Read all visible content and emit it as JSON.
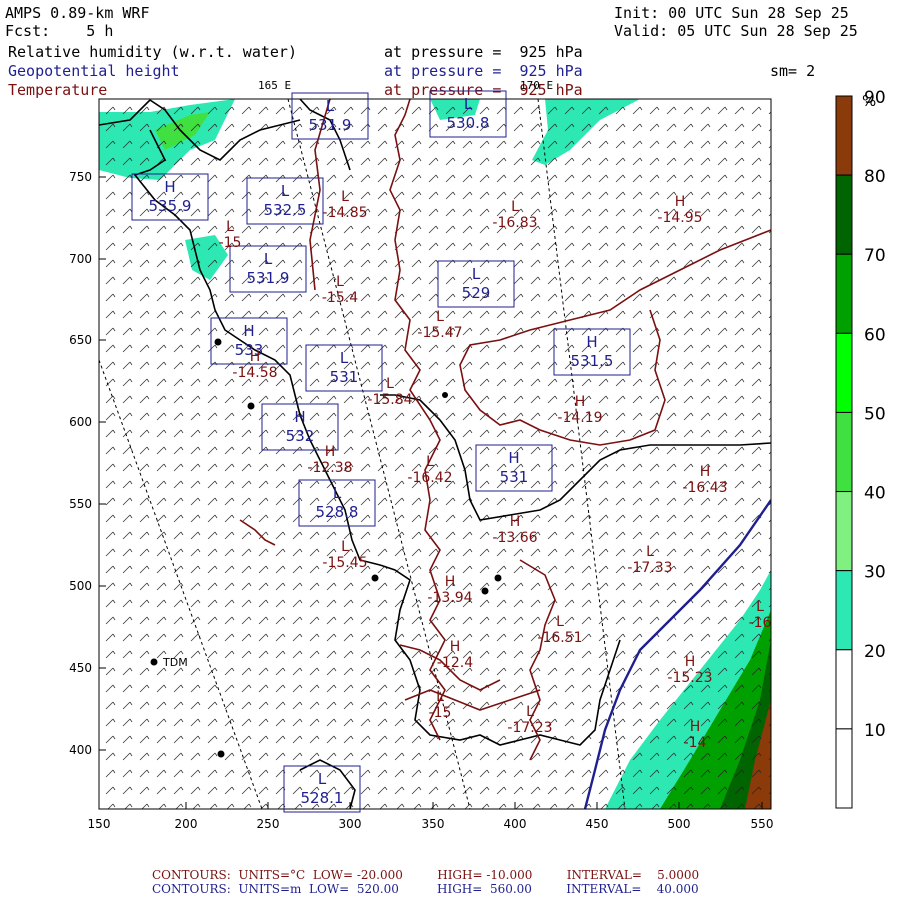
{
  "header": {
    "model": "AMPS 0.89-km WRF",
    "forecast": "Fcst:    5 h",
    "init": "Init: 00 UTC Sun 28 Sep 25",
    "valid": "Valid: 05 UTC Sun 28 Sep 25",
    "field1_name": "Relative humidity (w.r.t. water)",
    "field1_level": "at pressure =  925 hPa",
    "field2_name": "Geopotential height",
    "field2_level": "at pressure =  925 hPa",
    "field3_name": "Temperature",
    "field3_level": "at pressure =  925 hPa",
    "smoothing": "sm= 2",
    "meridian_165": "165 E",
    "meridian_170": "170 E"
  },
  "colorbar": {
    "unit": "%",
    "labels": [
      "10",
      "20",
      "30",
      "40",
      "50",
      "60",
      "70",
      "80",
      "90"
    ],
    "colors": [
      "#ffffff",
      "#ffffff",
      "#2ee8b4",
      "#80f080",
      "#40e040",
      "#00ff00",
      "#00a000",
      "#006400",
      "#8b3a0a"
    ]
  },
  "axes": {
    "x_ticks": [
      "150",
      "200",
      "250",
      "300",
      "350",
      "400",
      "450",
      "500",
      "550"
    ],
    "y_ticks": [
      "400",
      "450",
      "500",
      "550",
      "600",
      "650",
      "700",
      "750"
    ]
  },
  "height_labels": [
    {
      "tag": "H",
      "value": "535.9"
    },
    {
      "tag": "L",
      "value": "532.5"
    },
    {
      "tag": "L",
      "value": "531.9"
    },
    {
      "tag": "L",
      "value": "531.9"
    },
    {
      "tag": "L",
      "value": "530.8"
    },
    {
      "tag": "L",
      "value": "529"
    },
    {
      "tag": "H",
      "value": "533"
    },
    {
      "tag": "L",
      "value": "531"
    },
    {
      "tag": "H",
      "value": "532"
    },
    {
      "tag": "H",
      "value": "531.5"
    },
    {
      "tag": "H",
      "value": "531"
    },
    {
      "tag": "L",
      "value": "528.8"
    },
    {
      "tag": "L",
      "value": "528.1"
    }
  ],
  "temp_labels": [
    {
      "tag": "L",
      "value": "-14.85"
    },
    {
      "tag": "L",
      "value": "-16.83"
    },
    {
      "tag": "H",
      "value": "-14.95"
    },
    {
      "tag": "L",
      "value": "-15.4"
    },
    {
      "tag": "L",
      "value": "-15.47"
    },
    {
      "tag": "H",
      "value": "-14.58"
    },
    {
      "tag": "L",
      "value": "-15.84"
    },
    {
      "tag": "H",
      "value": "-14.19"
    },
    {
      "tag": "H",
      "value": "-12.38"
    },
    {
      "tag": "L",
      "value": "-16.42"
    },
    {
      "tag": "H",
      "value": "-16.43"
    },
    {
      "tag": "H",
      "value": "-13.66"
    },
    {
      "tag": "L",
      "value": "-15.45"
    },
    {
      "tag": "H",
      "value": "-13.94"
    },
    {
      "tag": "L",
      "value": "-17.33"
    },
    {
      "tag": "L",
      "value": "-16.51"
    },
    {
      "tag": "H",
      "value": "-12.4"
    },
    {
      "tag": "H",
      "value": "-15.23"
    },
    {
      "tag": "L",
      "value": "-15"
    },
    {
      "tag": "L",
      "value": "-17.23"
    },
    {
      "tag": "H",
      "value": "-14"
    },
    {
      "tag": "L",
      "value": "-16"
    },
    {
      "tag": "L",
      "value": "-15"
    }
  ],
  "stations": [
    {
      "label": "TDM"
    }
  ],
  "footer": {
    "line1": "CONTOURS:  UNITS=°C  LOW= -20.000         HIGH= -10.000         INTERVAL=    5.0000",
    "line2": "CONTOURS:  UNITS=m  LOW=  520.00          HIGH=  560.00         INTERVAL=    40.000"
  },
  "colors": {
    "temp_contour": "#7a1010",
    "height_contour": "#1f1f8f",
    "coast": "#000000",
    "rh_30_40": "#2ee8b4",
    "rh_60_70": "#00a000"
  }
}
